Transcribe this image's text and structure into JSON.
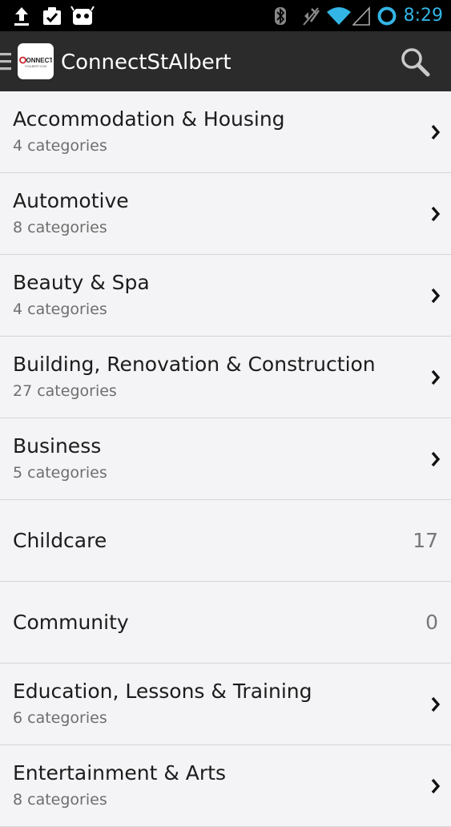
{
  "status_bar": {
    "time": "8:29",
    "icons": [
      "upload-icon",
      "clipboard-check-icon",
      "android-icon",
      "bluetooth-icon",
      "mute-icon",
      "wifi-icon",
      "signal-icon",
      "sync-ring-icon"
    ]
  },
  "action_bar": {
    "title": "ConnectStAlbert",
    "logo_text": "CONNECT",
    "logo_subtext": "STALBERT.COM",
    "icons": [
      "drawer-icon",
      "search-icon"
    ]
  },
  "categories": [
    {
      "title": "Accommodation & Housing",
      "subtitle": "4 categories"
    },
    {
      "title": "Automotive",
      "subtitle": "8 categories"
    },
    {
      "title": "Beauty & Spa",
      "subtitle": "4 categories"
    },
    {
      "title": "Building, Renovation & Construction",
      "subtitle": "27 categories"
    },
    {
      "title": "Business",
      "subtitle": "5 categories"
    },
    {
      "title": "Childcare",
      "count": "17"
    },
    {
      "title": "Community",
      "count": "0"
    },
    {
      "title": "Education, Lessons & Training",
      "subtitle": "6 categories"
    },
    {
      "title": "Entertainment & Arts",
      "subtitle": "8 categories"
    }
  ],
  "colors": {
    "status_bar_bg": "#000000",
    "action_bar_bg": "#2b2b2b",
    "accent": "#33b5e5",
    "list_bg": "#f4f3f5",
    "logo_red": "#c8262c"
  }
}
